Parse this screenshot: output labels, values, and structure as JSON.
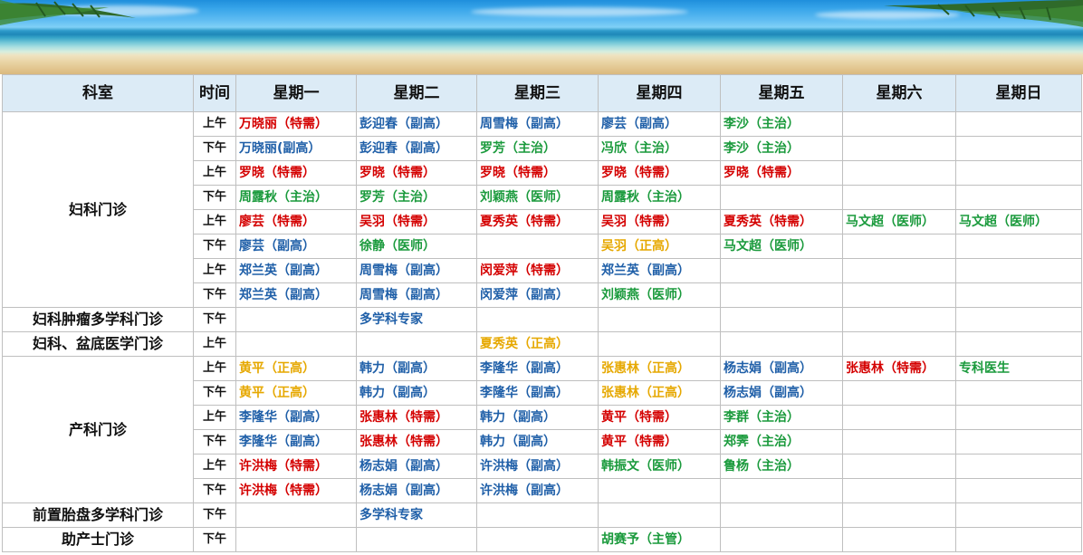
{
  "headers": [
    "科室",
    "时间",
    "星期一",
    "星期二",
    "星期三",
    "星期四",
    "星期五",
    "星期六",
    "星期日"
  ],
  "colors": {
    "r": "#d40000",
    "b": "#1f5fa8",
    "g": "#1a9a3c",
    "y": "#e6a800"
  },
  "departments": {
    "gyn": "妇科门诊",
    "gyn_tumor": "妇科肿瘤多学科门诊",
    "gyn_pelvic": "妇科、盆底医学门诊",
    "obs": "产科门诊",
    "placenta": "前置胎盘多学科门诊",
    "midwife": "助产士门诊"
  },
  "rows": [
    {
      "time": "上午",
      "cells": [
        {
          "t": "万晓丽（特需）",
          "c": "r"
        },
        {
          "t": "彭迎春（副高）",
          "c": "b"
        },
        {
          "t": "周雪梅（副高）",
          "c": "b"
        },
        {
          "t": "廖芸（副高）",
          "c": "b"
        },
        {
          "t": "李沙（主治）",
          "c": "g"
        },
        {
          "t": "",
          "c": ""
        },
        {
          "t": "",
          "c": ""
        }
      ]
    },
    {
      "time": "下午",
      "cells": [
        {
          "t": "万晓丽(副高）",
          "c": "b"
        },
        {
          "t": "彭迎春（副高）",
          "c": "b"
        },
        {
          "t": "罗芳（主治）",
          "c": "g"
        },
        {
          "t": "冯欣（主治）",
          "c": "g"
        },
        {
          "t": "李沙（主治）",
          "c": "g"
        },
        {
          "t": "",
          "c": ""
        },
        {
          "t": "",
          "c": ""
        }
      ]
    },
    {
      "time": "上午",
      "cells": [
        {
          "t": "罗晓（特需）",
          "c": "r"
        },
        {
          "t": "罗晓（特需）",
          "c": "r"
        },
        {
          "t": "罗晓（特需）",
          "c": "r"
        },
        {
          "t": "罗晓（特需）",
          "c": "r"
        },
        {
          "t": "罗晓（特需）",
          "c": "r"
        },
        {
          "t": "",
          "c": ""
        },
        {
          "t": "",
          "c": ""
        }
      ]
    },
    {
      "time": "下午",
      "cells": [
        {
          "t": "周露秋（主治）",
          "c": "g"
        },
        {
          "t": "罗芳（主治）",
          "c": "g"
        },
        {
          "t": "刘颖燕（医师）",
          "c": "g"
        },
        {
          "t": "周露秋（主治）",
          "c": "g"
        },
        {
          "t": "",
          "c": ""
        },
        {
          "t": "",
          "c": ""
        },
        {
          "t": "",
          "c": ""
        }
      ]
    },
    {
      "time": "上午",
      "cells": [
        {
          "t": "廖芸（特需）",
          "c": "r"
        },
        {
          "t": "吴羽（特需）",
          "c": "r"
        },
        {
          "t": "夏秀英（特需）",
          "c": "r"
        },
        {
          "t": "吴羽（特需）",
          "c": "r"
        },
        {
          "t": "夏秀英（特需）",
          "c": "r"
        },
        {
          "t": "马文超（医师）",
          "c": "g"
        },
        {
          "t": "马文超（医师）",
          "c": "g"
        }
      ]
    },
    {
      "time": "下午",
      "cells": [
        {
          "t": "廖芸（副高）",
          "c": "b"
        },
        {
          "t": "徐静（医师）",
          "c": "g"
        },
        {
          "t": "",
          "c": ""
        },
        {
          "t": "吴羽（正高）",
          "c": "y"
        },
        {
          "t": "马文超（医师）",
          "c": "g"
        },
        {
          "t": "",
          "c": ""
        },
        {
          "t": "",
          "c": ""
        }
      ]
    },
    {
      "time": "上午",
      "cells": [
        {
          "t": "郑兰英（副高）",
          "c": "b"
        },
        {
          "t": "周雪梅（副高）",
          "c": "b"
        },
        {
          "t": "闵爱萍（特需）",
          "c": "r"
        },
        {
          "t": "郑兰英（副高）",
          "c": "b"
        },
        {
          "t": "",
          "c": ""
        },
        {
          "t": "",
          "c": ""
        },
        {
          "t": "",
          "c": ""
        }
      ]
    },
    {
      "time": "下午",
      "cells": [
        {
          "t": "郑兰英（副高）",
          "c": "b"
        },
        {
          "t": "周雪梅（副高）",
          "c": "b"
        },
        {
          "t": "闵爱萍（副高）",
          "c": "b"
        },
        {
          "t": "刘颖燕（医师）",
          "c": "g"
        },
        {
          "t": "",
          "c": ""
        },
        {
          "t": "",
          "c": ""
        },
        {
          "t": "",
          "c": ""
        }
      ]
    },
    {
      "time": "下午",
      "cells": [
        {
          "t": "",
          "c": ""
        },
        {
          "t": "多学科专家",
          "c": "b"
        },
        {
          "t": "",
          "c": ""
        },
        {
          "t": "",
          "c": ""
        },
        {
          "t": "",
          "c": ""
        },
        {
          "t": "",
          "c": ""
        },
        {
          "t": "",
          "c": ""
        }
      ]
    },
    {
      "time": "上午",
      "cells": [
        {
          "t": "",
          "c": ""
        },
        {
          "t": "",
          "c": ""
        },
        {
          "t": "夏秀英（正高）",
          "c": "y"
        },
        {
          "t": "",
          "c": ""
        },
        {
          "t": "",
          "c": ""
        },
        {
          "t": "",
          "c": ""
        },
        {
          "t": "",
          "c": ""
        }
      ]
    },
    {
      "time": "上午",
      "cells": [
        {
          "t": "黄平（正高）",
          "c": "y"
        },
        {
          "t": "韩力（副高）",
          "c": "b"
        },
        {
          "t": "李隆华（副高）",
          "c": "b"
        },
        {
          "t": "张惠林（正高）",
          "c": "y"
        },
        {
          "t": "杨志娟（副高）",
          "c": "b"
        },
        {
          "t": "张惠林（特需）",
          "c": "r"
        },
        {
          "t": "专科医生",
          "c": "g"
        }
      ]
    },
    {
      "time": "下午",
      "cells": [
        {
          "t": "黄平（正高）",
          "c": "y"
        },
        {
          "t": "韩力（副高）",
          "c": "b"
        },
        {
          "t": "李隆华（副高）",
          "c": "b"
        },
        {
          "t": "张惠林（正高）",
          "c": "y"
        },
        {
          "t": "杨志娟（副高）",
          "c": "b"
        },
        {
          "t": "",
          "c": ""
        },
        {
          "t": "",
          "c": ""
        }
      ]
    },
    {
      "time": "上午",
      "cells": [
        {
          "t": "李隆华（副高）",
          "c": "b"
        },
        {
          "t": "张惠林（特需）",
          "c": "r"
        },
        {
          "t": "韩力（副高）",
          "c": "b"
        },
        {
          "t": "黄平（特需）",
          "c": "r"
        },
        {
          "t": "李群（主治）",
          "c": "g"
        },
        {
          "t": "",
          "c": ""
        },
        {
          "t": "",
          "c": ""
        }
      ]
    },
    {
      "time": "下午",
      "cells": [
        {
          "t": "李隆华（副高）",
          "c": "b"
        },
        {
          "t": "张惠林（特需）",
          "c": "r"
        },
        {
          "t": "韩力（副高）",
          "c": "b"
        },
        {
          "t": "黄平（特需）",
          "c": "r"
        },
        {
          "t": "郑霁（主治）",
          "c": "g"
        },
        {
          "t": "",
          "c": ""
        },
        {
          "t": "",
          "c": ""
        }
      ]
    },
    {
      "time": "上午",
      "cells": [
        {
          "t": "许洪梅（特需）",
          "c": "r"
        },
        {
          "t": "杨志娟（副高）",
          "c": "b"
        },
        {
          "t": "许洪梅（副高）",
          "c": "b"
        },
        {
          "t": "韩振文（医师）",
          "c": "g"
        },
        {
          "t": "鲁杨（主治）",
          "c": "g"
        },
        {
          "t": "",
          "c": ""
        },
        {
          "t": "",
          "c": ""
        }
      ]
    },
    {
      "time": "下午",
      "cells": [
        {
          "t": "许洪梅（特需）",
          "c": "r"
        },
        {
          "t": "杨志娟（副高）",
          "c": "b"
        },
        {
          "t": "许洪梅（副高）",
          "c": "b"
        },
        {
          "t": "",
          "c": ""
        },
        {
          "t": "",
          "c": ""
        },
        {
          "t": "",
          "c": ""
        },
        {
          "t": "",
          "c": ""
        }
      ]
    },
    {
      "time": "下午",
      "cells": [
        {
          "t": "",
          "c": ""
        },
        {
          "t": "多学科专家",
          "c": "b"
        },
        {
          "t": "",
          "c": ""
        },
        {
          "t": "",
          "c": ""
        },
        {
          "t": "",
          "c": ""
        },
        {
          "t": "",
          "c": ""
        },
        {
          "t": "",
          "c": ""
        }
      ]
    },
    {
      "time": "下午",
      "cells": [
        {
          "t": "",
          "c": ""
        },
        {
          "t": "",
          "c": ""
        },
        {
          "t": "",
          "c": ""
        },
        {
          "t": "胡赛予（主管）",
          "c": "g"
        },
        {
          "t": "",
          "c": ""
        },
        {
          "t": "",
          "c": ""
        },
        {
          "t": "",
          "c": ""
        }
      ]
    }
  ]
}
